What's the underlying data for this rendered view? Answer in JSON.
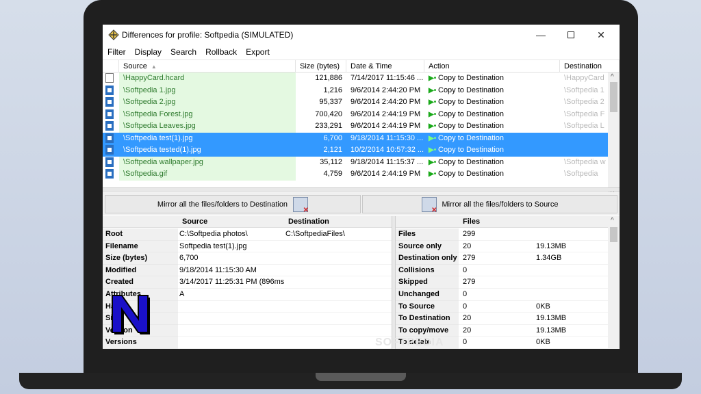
{
  "window": {
    "title": "Differences for profile: Softpedia (SIMULATED)",
    "minimize_icon": "minimize-icon",
    "maximize_icon": "maximize-icon",
    "close_icon": "close-icon"
  },
  "menu": [
    "Filter",
    "Display",
    "Search",
    "Rollback",
    "Export"
  ],
  "grid": {
    "headers": {
      "source": "Source",
      "size": "Size (bytes)",
      "date": "Date & Time",
      "action": "Action",
      "destination": "Destination"
    },
    "rows": [
      {
        "icon": "file-icon",
        "source": "\\HappyCard.hcard",
        "size": "121,886",
        "date": "7/14/2017 11:15:46 ...",
        "action": "Copy to Destination",
        "dest": "\\HappyCard",
        "selected": false
      },
      {
        "icon": "image-file-icon",
        "source": "\\Softpedia 1.jpg",
        "size": "1,216",
        "date": "9/6/2014 2:44:20 PM",
        "action": "Copy to Destination",
        "dest": "\\Softpedia 1",
        "selected": false
      },
      {
        "icon": "image-file-icon",
        "source": "\\Softpedia 2.jpg",
        "size": "95,337",
        "date": "9/6/2014 2:44:20 PM",
        "action": "Copy to Destination",
        "dest": "\\Softpedia 2",
        "selected": false
      },
      {
        "icon": "image-file-icon",
        "source": "\\Softpedia Forest.jpg",
        "size": "700,420",
        "date": "9/6/2014 2:44:19 PM",
        "action": "Copy to Destination",
        "dest": "\\Softpedia F",
        "selected": false
      },
      {
        "icon": "image-file-icon",
        "source": "\\Softpedia Leaves.jpg",
        "size": "233,291",
        "date": "9/6/2014 2:44:19 PM",
        "action": "Copy to Destination",
        "dest": "\\Softpedia L",
        "selected": false
      },
      {
        "icon": "image-file-icon",
        "source": "\\Softpedia test(1).jpg",
        "size": "6,700",
        "date": "9/18/2014 11:15:30 ...",
        "action": "Copy to Destination",
        "dest": "",
        "selected": true
      },
      {
        "icon": "image-file-icon",
        "source": "\\Softpedia tested(1).jpg",
        "size": "2,121",
        "date": "10/2/2014 10:57:32 ...",
        "action": "Copy to Destination",
        "dest": "",
        "selected": true
      },
      {
        "icon": "image-file-icon",
        "source": "\\Softpedia wallpaper.jpg",
        "size": "35,112",
        "date": "9/18/2014 11:15:37 ...",
        "action": "Copy to Destination",
        "dest": "\\Softpedia w",
        "selected": false
      },
      {
        "icon": "image-file-icon",
        "source": "\\Softpedia.gif",
        "size": "4,759",
        "date": "9/6/2014 2:44:19 PM",
        "action": "Copy to Destination",
        "dest": "\\Softpedia",
        "selected": false
      }
    ]
  },
  "mirror": {
    "to_destination": "Mirror all the files/folders to Destination",
    "to_source": "Mirror all the files/folders to Source"
  },
  "props": {
    "headers": {
      "source": "Source",
      "destination": "Destination"
    },
    "rows": [
      {
        "label": "Root",
        "source": "C:\\Softpedia photos\\",
        "dest": "C:\\SoftpediaFiles\\"
      },
      {
        "label": "Filename",
        "source": "Softpedia test(1).jpg",
        "dest": ""
      },
      {
        "label": "Size (bytes)",
        "source": "6,700",
        "dest": ""
      },
      {
        "label": "Modified",
        "source": "9/18/2014 11:15:30 AM",
        "dest": ""
      },
      {
        "label": "Created",
        "source": "3/14/2017 11:25:31 PM (896ms)",
        "dest": ""
      },
      {
        "label": "Attributes",
        "source": "A",
        "dest": ""
      },
      {
        "label": "Hash",
        "source": "",
        "dest": ""
      },
      {
        "label": "Size",
        "source": "",
        "dest": ""
      },
      {
        "label": "Version",
        "source": "",
        "dest": ""
      },
      {
        "label": "Versions",
        "source": "",
        "dest": ""
      }
    ]
  },
  "stats": {
    "header": "Files",
    "rows": [
      {
        "label": "Files",
        "count": "299",
        "size": ""
      },
      {
        "label": "Source only",
        "count": "20",
        "size": "19.13MB"
      },
      {
        "label": "Destination only",
        "count": "279",
        "size": "1.34GB"
      },
      {
        "label": "Collisions",
        "count": "0",
        "size": ""
      },
      {
        "label": "Skipped",
        "count": "279",
        "size": ""
      },
      {
        "label": "Unchanged",
        "count": "0",
        "size": ""
      },
      {
        "label": "To Source",
        "count": "0",
        "size": "0KB"
      },
      {
        "label": "To Destination",
        "count": "20",
        "size": "19.13MB"
      },
      {
        "label": "To copy/move",
        "count": "20",
        "size": "19.13MB"
      },
      {
        "label": "To delete",
        "count": "0",
        "size": "0KB"
      }
    ]
  },
  "watermark": "SOFTPEDIA",
  "colors": {
    "selected": "#3399ff",
    "source_cell_bg": "#e4f9e1",
    "source_text": "#2d7a2d",
    "action_arrow": "#1aa91a",
    "logo": "#1a10c8"
  }
}
